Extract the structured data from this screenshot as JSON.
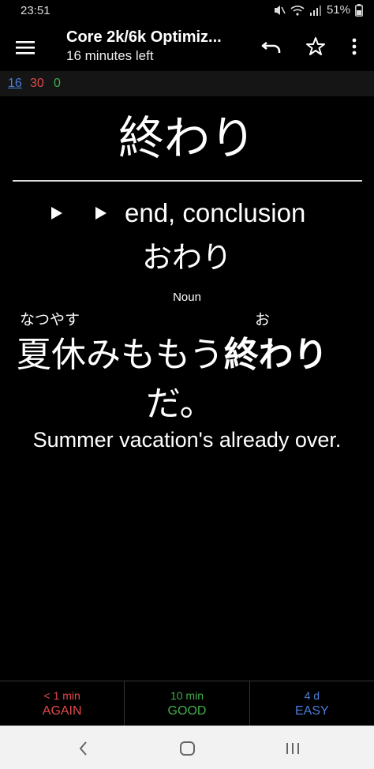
{
  "status_bar": {
    "time": "23:51",
    "battery": "51%"
  },
  "toolbar": {
    "title": "Core 2k/6k Optimiz...",
    "subtitle": "16 minutes left",
    "icons": [
      "menu-icon",
      "undo-icon",
      "star-icon",
      "more-vert-icon"
    ]
  },
  "counts": {
    "new": "16",
    "learning": "30",
    "review": "0"
  },
  "card": {
    "word": "終わり",
    "meaning": "end, conclusion",
    "reading": "おわり",
    "part_of_speech": "Noun",
    "sentence": {
      "furigana_1": "なつやす",
      "furigana_2": "お",
      "line1_plain": "夏休みももう",
      "line1_bold": "終わり",
      "line2": "だ。"
    },
    "translation": "Summer vacation's already over."
  },
  "answers": [
    {
      "time": "< 1 min",
      "label": "AGAIN",
      "color": "#e24a4a"
    },
    {
      "time": "10 min",
      "label": "GOOD",
      "color": "#3fae4a"
    },
    {
      "time": "4 d",
      "label": "EASY",
      "color": "#4a7ed8"
    }
  ],
  "colors": {
    "background": "#000000",
    "new_count": "#4a7ed8",
    "learning_count": "#e04848",
    "review_count": "#3fae4a"
  }
}
